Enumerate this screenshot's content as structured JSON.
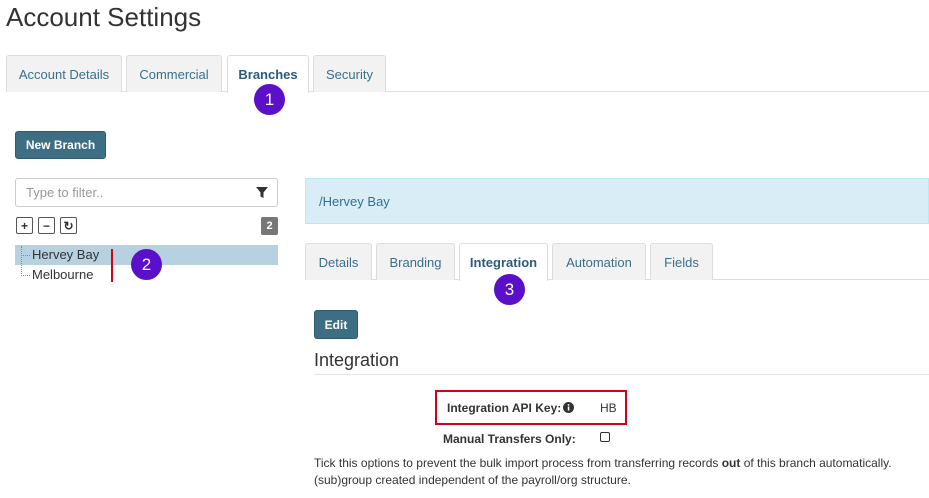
{
  "page_title": "Account Settings",
  "top_tabs": [
    {
      "label": "Account Details"
    },
    {
      "label": "Commercial"
    },
    {
      "label": "Branches"
    },
    {
      "label": "Security"
    }
  ],
  "annotations": {
    "one": "1",
    "two": "2",
    "three": "3"
  },
  "new_branch_label": "New Branch",
  "filter": {
    "placeholder": "Type to filter.."
  },
  "tree": {
    "count": "2",
    "add_symbol": "+",
    "remove_symbol": "−",
    "refresh_symbol": "↻",
    "items": [
      {
        "label": "Hervey Bay"
      },
      {
        "label": "Melbourne"
      }
    ]
  },
  "breadcrumb": "/Hervey Bay",
  "sub_tabs": [
    {
      "label": "Details"
    },
    {
      "label": "Branding"
    },
    {
      "label": "Integration"
    },
    {
      "label": "Automation"
    },
    {
      "label": "Fields"
    }
  ],
  "edit_label": "Edit",
  "section_title": "Integration",
  "fields": {
    "api_key_label": "Integration API Key:",
    "api_key_value": "HB",
    "manual_label": "Manual Transfers Only:"
  },
  "help": {
    "before": "Tick this options to prevent the bulk import process from transferring records ",
    "bold": "out",
    "after": " of this branch automatically.",
    "line2": "(sub)group created independent of the payroll/org structure."
  },
  "colors": {
    "accent": "#3d6e83",
    "badge": "#5b0fc9",
    "highlight": "#b8d1e1",
    "callout": "#d0021b"
  }
}
